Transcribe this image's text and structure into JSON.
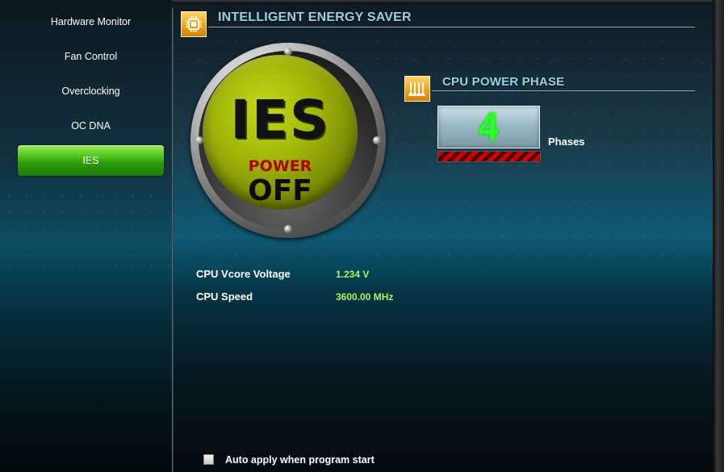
{
  "sidebar": {
    "items": [
      {
        "label": "Hardware Monitor",
        "active": false
      },
      {
        "label": "Fan Control",
        "active": false
      },
      {
        "label": "Overclocking",
        "active": false
      },
      {
        "label": "OC DNA",
        "active": false
      },
      {
        "label": "IES",
        "active": true
      }
    ]
  },
  "ies_section": {
    "title": "INTELLIGENT ENERGY SAVER",
    "icon": "chip-icon",
    "button": {
      "logo": "IES",
      "power_label": "POWER",
      "state": "OFF"
    }
  },
  "phase_section": {
    "title": "CPU POWER PHASE",
    "icon": "power-phase-icon",
    "phase_count": "4",
    "phase_unit": "Phases"
  },
  "info": {
    "vcore_label": "CPU Vcore Voltage",
    "vcore_value": "1.234 V",
    "speed_label": "CPU Speed",
    "speed_value": "3600.00 MHz"
  },
  "auto_apply": {
    "label": "Auto apply when program start",
    "checked": false
  },
  "colors": {
    "active_green": "#4fc61e",
    "value_green": "#a8f56a",
    "section_title": "#9ad2e8",
    "digit_green": "#2bff2b"
  }
}
